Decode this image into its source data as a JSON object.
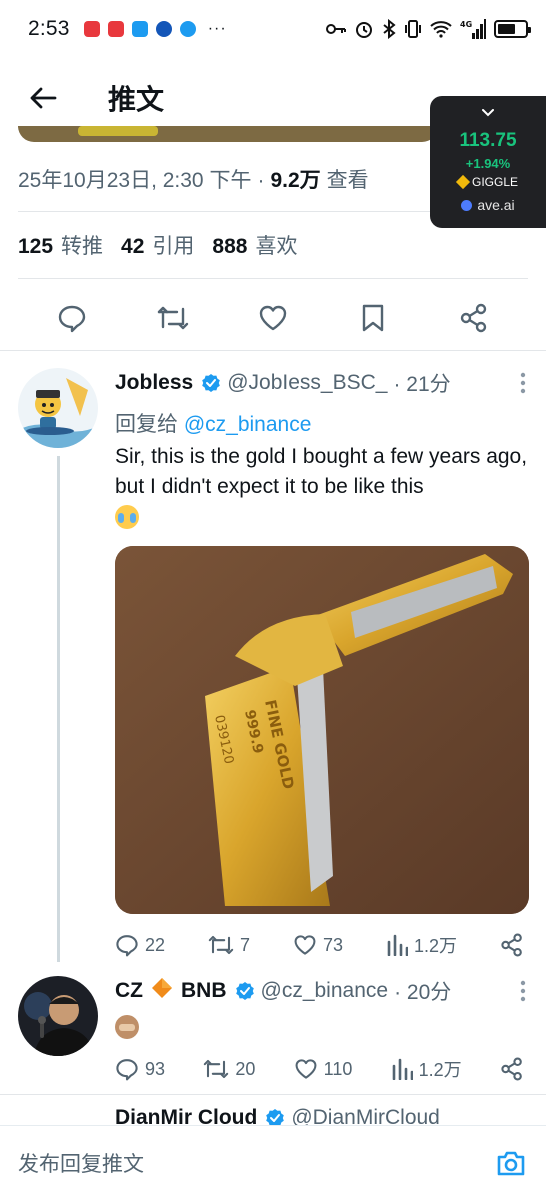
{
  "status_bar": {
    "time": "2:53",
    "app_colors": [
      "#e8383d",
      "#e8383d",
      "#1d9bf0",
      "#1456b8",
      "#1d9bf0"
    ],
    "more": "···",
    "network": "4G",
    "battery_level": 0.65
  },
  "header": {
    "title": "推文"
  },
  "floating_widget": {
    "price": "113.75",
    "change": "+1.94%",
    "token": "GIGGLE",
    "brand": "ave.ai"
  },
  "tweet_meta": {
    "datetime": "25年10月23日, 2:30 下午",
    "separator": "·",
    "views": "9.2万",
    "views_label": "查看"
  },
  "stats": {
    "retweets": "125",
    "retweets_label": "转推",
    "quotes": "42",
    "quotes_label": "引用",
    "likes": "888",
    "likes_label": "喜欢"
  },
  "replies": [
    {
      "name": "Jobless",
      "handle": "@JobIess_BSC_",
      "time": "· 21分",
      "reply_to_label": "回复给",
      "reply_to_handle": "@cz_binance",
      "text": "Sir, this is the gold I bought a few years ago, but I didn't expect it to be like this",
      "replies": "22",
      "retweets": "7",
      "likes": "73",
      "views": "1.2万"
    },
    {
      "name": "CZ",
      "name_suffix": "BNB",
      "handle": "@cz_binance",
      "time": "· 20分",
      "replies": "93",
      "retweets": "20",
      "likes": "110",
      "views": "1.2万"
    },
    {
      "name": "DianMir Cloud",
      "handle": "@DianMirCloud"
    }
  ],
  "compose": {
    "placeholder": "发布回复推文"
  },
  "colors": {
    "accent": "#1d9bf0",
    "secondary_text": "#536471",
    "positive": "#19c37d",
    "divider": "#e3e6e9"
  }
}
